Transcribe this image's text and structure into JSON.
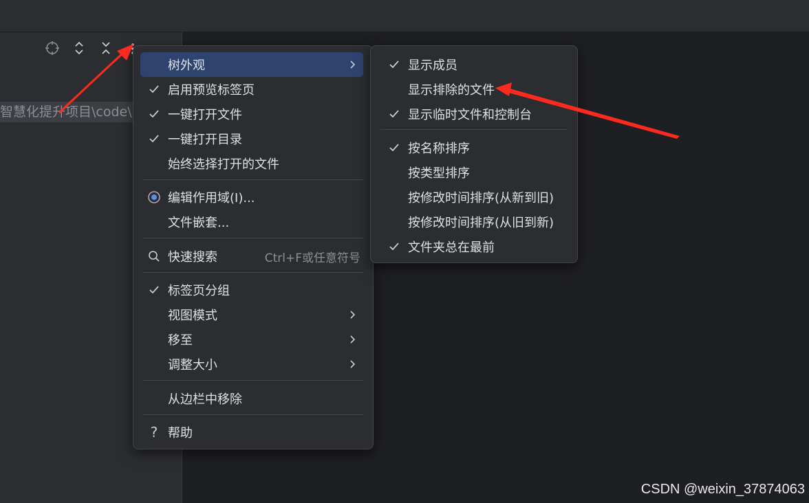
{
  "project_panel": {
    "path_text": "智慧化提升项目\\code\\p",
    "toolbar": {
      "locate_icon": "crosshair-icon",
      "expand_icon": "expand-all-icon",
      "collapse_icon": "collapse-all-icon",
      "options_icon": "more-vertical-icon"
    }
  },
  "main_menu": {
    "items": [
      {
        "label": "树外观",
        "check": false,
        "submenu": true,
        "highlighted": true
      },
      {
        "label": "启用预览标签页",
        "check": true
      },
      {
        "label": "一键打开文件",
        "check": true
      },
      {
        "label": "一键打开目录",
        "check": true
      },
      {
        "label": "始终选择打开的文件",
        "check": false
      },
      {
        "label": "编辑作用域(I)...",
        "icon": "scope-radio-icon"
      },
      {
        "label": "文件嵌套..."
      },
      {
        "label": "快速搜索",
        "icon": "search-icon",
        "shortcut": "Ctrl+F或任意符号"
      },
      {
        "label": "标签页分组",
        "check": true
      },
      {
        "label": "视图模式",
        "submenu": true
      },
      {
        "label": "移至",
        "submenu": true
      },
      {
        "label": "调整大小",
        "submenu": true
      },
      {
        "label": "从边栏中移除"
      },
      {
        "label": "帮助",
        "icon": "help-icon"
      }
    ]
  },
  "sub_menu": {
    "items": [
      {
        "label": "显示成员",
        "check": true
      },
      {
        "label": "显示排除的文件",
        "check": false
      },
      {
        "label": "显示临时文件和控制台",
        "check": true
      },
      {
        "label": "按名称排序",
        "check": true
      },
      {
        "label": "按类型排序",
        "check": false
      },
      {
        "label": "按修改时间排序(从新到旧)",
        "check": false
      },
      {
        "label": "按修改时间排序(从旧到新)",
        "check": false
      },
      {
        "label": "文件夹总在最前",
        "check": true
      }
    ]
  },
  "watermark": "CSDN @weixin_37874063",
  "colors": {
    "background": "#2b2d30",
    "editor": "#1e1f22",
    "menu_highlight": "#2e436e",
    "annotation_arrow": "#ff2a1f"
  }
}
